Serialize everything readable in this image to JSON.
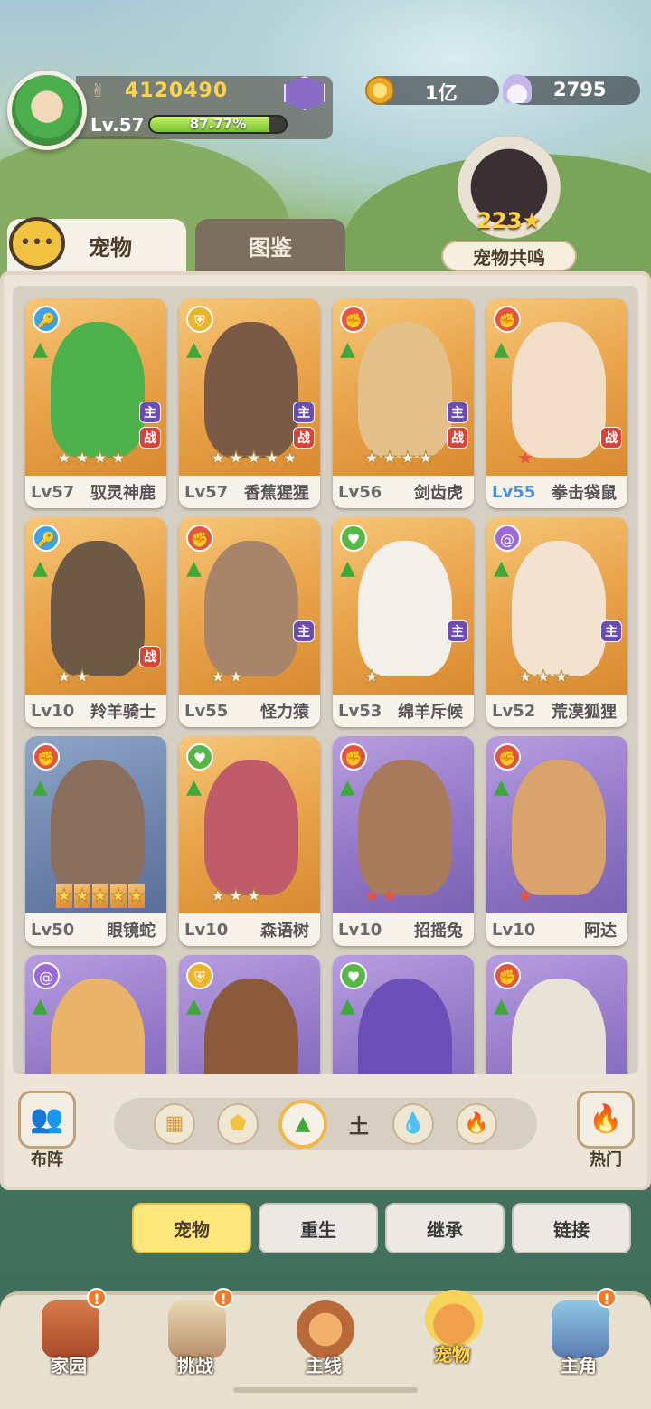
{
  "profile": {
    "power": "4120490",
    "level": "Lv.57",
    "xp_text": "87.77%",
    "xp_fraction": 0.8777
  },
  "resources": {
    "coins": "1亿",
    "shells": "2795"
  },
  "resonance": {
    "count": "223",
    "label": "宠物共鸣"
  },
  "tabs": {
    "pets": "宠物",
    "codex": "图鉴"
  },
  "pets": [
    {
      "level": "Lv57",
      "name": "驭灵神鹿",
      "stars": 4,
      "star_color": "white",
      "class_icon": "key",
      "class_color": "#3ea3e6",
      "badges": [
        "主",
        "战"
      ],
      "art": "gold",
      "body": "#4cb14a"
    },
    {
      "level": "Lv57",
      "name": "香蕉猩猩",
      "stars": 5,
      "star_color": "white",
      "class_icon": "shield",
      "class_color": "#e8b62d",
      "badges": [
        "主",
        "战"
      ],
      "art": "gold",
      "body": "#7a5a46"
    },
    {
      "level": "Lv56",
      "name": "剑齿虎",
      "stars": 4,
      "star_color": "white",
      "class_icon": "axe",
      "class_color": "#e2553f",
      "badges": [
        "主",
        "战"
      ],
      "art": "gold",
      "body": "#e3c08a"
    },
    {
      "level": "Lv55",
      "name": "拳击袋鼠",
      "stars": 1,
      "star_color": "red",
      "class_icon": "axe",
      "class_color": "#e2553f",
      "badges": [
        "战"
      ],
      "art": "gold",
      "body": "#f1ddc8",
      "level_blue": true
    },
    {
      "level": "Lv10",
      "name": "羚羊骑士",
      "stars": 2,
      "star_color": "white",
      "class_icon": "key",
      "class_color": "#3ea3e6",
      "badges": [
        "战"
      ],
      "art": "gold",
      "body": "#6d5a46"
    },
    {
      "level": "Lv55",
      "name": "怪力猿",
      "stars": 2,
      "star_color": "white",
      "class_icon": "axe",
      "class_color": "#e2553f",
      "badges": [
        "主"
      ],
      "art": "gold",
      "body": "#a8856a"
    },
    {
      "level": "Lv53",
      "name": "绵羊斥候",
      "stars": 1,
      "star_color": "white",
      "class_icon": "heart",
      "class_color": "#57b84a",
      "badges": [
        "主"
      ],
      "art": "gold",
      "body": "#f3f0ea"
    },
    {
      "level": "Lv52",
      "name": "荒漠狐狸",
      "stars": 3,
      "star_color": "white",
      "class_icon": "swirl",
      "class_color": "#9a6ad6",
      "badges": [
        "主"
      ],
      "art": "gold",
      "body": "#f2e2cf"
    },
    {
      "level": "Lv50",
      "name": "眼镜蛇",
      "stars": 5,
      "star_color": "gold",
      "class_icon": "axe",
      "class_color": "#e2553f",
      "badges": [],
      "art": "blue",
      "body": "#8b6f5e"
    },
    {
      "level": "Lv10",
      "name": "森语树",
      "stars": 3,
      "star_color": "white",
      "class_icon": "heart",
      "class_color": "#57b84a",
      "badges": [],
      "art": "gold",
      "body": "#c05b6a"
    },
    {
      "level": "Lv10",
      "name": "招摇兔",
      "stars": 2,
      "star_color": "red",
      "class_icon": "axe",
      "class_color": "#e2553f",
      "badges": [],
      "art": "purple",
      "body": "#a67a5a"
    },
    {
      "level": "Lv10",
      "name": "阿达",
      "stars": 1,
      "star_color": "red",
      "class_icon": "axe",
      "class_color": "#e2553f",
      "badges": [],
      "art": "purple",
      "body": "#d9a36d"
    },
    {
      "level": "",
      "name": "",
      "stars": 0,
      "star_color": "white",
      "class_icon": "swirl",
      "class_color": "#9a6ad6",
      "badges": [],
      "art": "purple",
      "body": "#e9b46a"
    },
    {
      "level": "",
      "name": "",
      "stars": 0,
      "star_color": "white",
      "class_icon": "shield",
      "class_color": "#e8b62d",
      "badges": [],
      "art": "purple",
      "body": "#8a5a3a"
    },
    {
      "level": "",
      "name": "",
      "stars": 0,
      "star_color": "white",
      "class_icon": "heart",
      "class_color": "#57b84a",
      "badges": [],
      "art": "purple",
      "body": "#6a4fb8"
    },
    {
      "level": "",
      "name": "",
      "stars": 0,
      "star_color": "white",
      "class_icon": "axe",
      "class_color": "#e2553f",
      "badges": [],
      "art": "purple",
      "body": "#e9e2d6"
    }
  ],
  "filters": {
    "lineup": "布阵",
    "hot": "热门",
    "earth": "土"
  },
  "subtabs": [
    "宠物",
    "重生",
    "继承",
    "链接"
  ],
  "nav": [
    {
      "label": "家园",
      "notif": "!"
    },
    {
      "label": "挑战",
      "notif": "!"
    },
    {
      "label": "主线",
      "notif": ""
    },
    {
      "label": "宠物",
      "notif": ""
    },
    {
      "label": "主角",
      "notif": "!"
    }
  ]
}
